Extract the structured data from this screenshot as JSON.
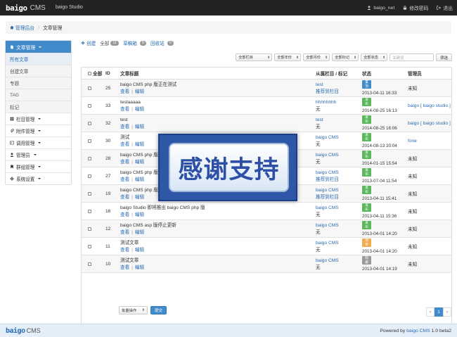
{
  "topbar": {
    "logo": "baigo",
    "cms": "CMS",
    "studio": "baigo Studio",
    "user": "baigo_net",
    "change_password": "修改密码",
    "logout": "退出"
  },
  "breadcrumb": {
    "home": "管理后台",
    "separator": "/",
    "current": "文章管理"
  },
  "sidebar": {
    "header": "文章管理",
    "items": [
      "所有文章",
      "创建文章",
      "专题",
      "TAG",
      "标记"
    ],
    "groups": [
      "栏目管理",
      "附件管理",
      "调用管理",
      "管理员",
      "群组管理",
      "系统设置"
    ]
  },
  "toolbar": {
    "create": "创建",
    "all": "全部",
    "all_count": "11",
    "draft": "草稿箱",
    "draft_count": "0",
    "recycle": "回收站",
    "recycle_count": "0"
  },
  "filters": {
    "column": "全部栏目",
    "year": "全部年份",
    "month": "全部月份",
    "mark": "全部标记",
    "status": "全部状态",
    "keyword_placeholder": "关键词",
    "submit": "筛选"
  },
  "table": {
    "headers": {
      "check_all": "全部",
      "id": "ID",
      "title": "文章标题",
      "category": "从属栏目 / 标记",
      "status": "状态",
      "admin": "管理员"
    },
    "view": "查看",
    "edit": "编辑",
    "rows": [
      {
        "id": "25",
        "title": "baigo CMS php 版正在测试",
        "cat": "test",
        "mark": "推荐到栏目",
        "status": "置顶",
        "status_color": "#428bca",
        "time": "2013-04-11 16:33",
        "admin": "未知",
        "admin_link": false
      },
      {
        "id": "33",
        "title": "testaaaaa",
        "cat": "hhhhhhhh",
        "mark": "无",
        "status": "发布",
        "status_color": "#5cb85c",
        "time": "2014-08-25 16:13",
        "admin": "baigo [ baigo studio ]",
        "admin_link": true
      },
      {
        "id": "32",
        "title": "test",
        "cat": "test",
        "mark": "无",
        "status": "发布",
        "status_color": "#5cb85c",
        "time": "2014-08-25 16:06",
        "admin": "baigo [ baigo studio ]",
        "admin_link": true
      },
      {
        "id": "30",
        "title": "测试",
        "cat": "baigo CMS",
        "mark": "无",
        "status": "发布",
        "status_color": "#5cb85c",
        "time": "2014-08-13 20:04",
        "admin": "fone",
        "admin_link": true
      },
      {
        "id": "28",
        "title": "baigo CMS php 版 1",
        "cat": "baigo CMS",
        "mark": "无",
        "status": "发布",
        "status_color": "#5cb85c",
        "time": "2014-01-15 15:54",
        "admin": "未知",
        "admin_link": false
      },
      {
        "id": "27",
        "title": "baigo CMS php 版 1",
        "cat": "baigo CMS",
        "mark": "推荐到栏目",
        "status": "发布",
        "status_color": "#5cb85c",
        "time": "2013-07-04 11:54",
        "admin": "未知",
        "admin_link": false
      },
      {
        "id": "19",
        "title": "baigo CMS php 版开",
        "cat": "baigo CMS",
        "mark": "推荐到栏目",
        "status": "发布",
        "status_color": "#5cb85c",
        "time": "2013-04-11 15:41",
        "admin": "未知",
        "admin_link": false
      },
      {
        "id": "16",
        "title": "baigo Studio 即将推出 baigo CMS php 版",
        "cat": "baigo CMS",
        "mark": "无",
        "status": "发布",
        "status_color": "#5cb85c",
        "time": "2013-04-11 15:36",
        "admin": "未知",
        "admin_link": false
      },
      {
        "id": "12",
        "title": "baigo CMS asp 版停止更新",
        "cat": "baigo CMS",
        "mark": "无",
        "status": "发布",
        "status_color": "#5cb85c",
        "time": "2013-04-01 14:20",
        "admin": "未知",
        "admin_link": false
      },
      {
        "id": "11",
        "title": "测试文章",
        "cat": "baigo CMS",
        "mark": "无",
        "status": "待审",
        "status_color": "#f0ad4e",
        "time": "2013-04-01 14:20",
        "admin": "未知",
        "admin_link": false
      },
      {
        "id": "10",
        "title": "测试文章",
        "cat": "baigo CMS",
        "mark": "无",
        "status": "隐藏",
        "status_color": "#999999",
        "time": "2013-04-01 14:19",
        "admin": "未知",
        "admin_link": false
      }
    ]
  },
  "bulk": {
    "select": "批量操作",
    "submit": "提交"
  },
  "pagination": {
    "prev": "«",
    "current": "1",
    "next": "»"
  },
  "footer": {
    "logo": "baigo",
    "cms": "CMS",
    "powered_prefix": "Powered by",
    "powered_link": "baigo CMS",
    "version": "1.0 beta2"
  },
  "overlay": {
    "text": "感谢支持"
  }
}
